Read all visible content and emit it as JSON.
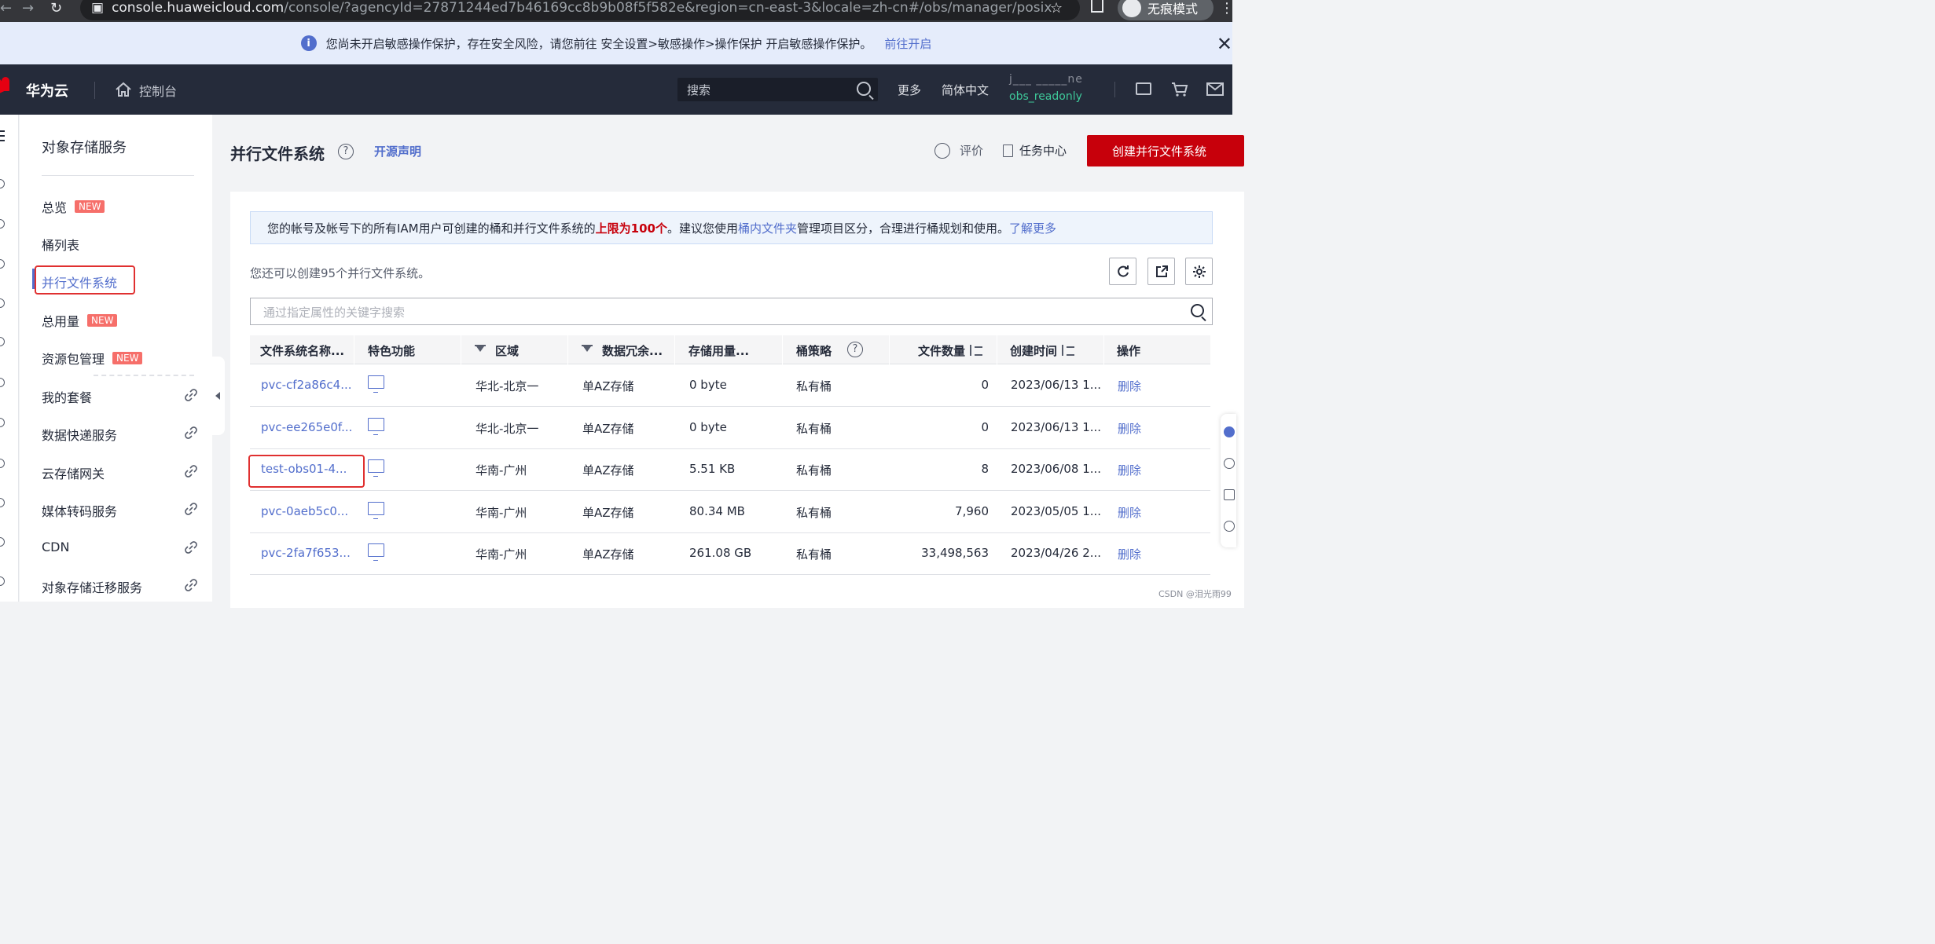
{
  "browser": {
    "url_host": "console.huaweicloud.com",
    "url_path": "/console/?agencyId=27871244ed7b46169cc8b9b08f5f582e&region=cn-east-3&locale=zh-cn#/obs/manager/posix",
    "incognito_label": "无痕模式"
  },
  "banner": {
    "message": "您尚未开启敏感操作保护，存在安全风险，请您前往 安全设置>敏感操作>操作保护 开启敏感操作保护。",
    "link": "前往开启"
  },
  "topnav": {
    "brand": "华为云",
    "console": "控制台",
    "search_placeholder": "搜索",
    "more": "更多",
    "language": "简体中文",
    "user_line1": "j___  _____ne",
    "user_line2": "obs_readonly"
  },
  "sidebar": {
    "title": "对象存储服务",
    "new_tag": "NEW",
    "items": [
      {
        "label": "总览",
        "new": true
      },
      {
        "label": "桶列表",
        "new": false
      },
      {
        "label": "并行文件系统",
        "new": false
      },
      {
        "label": "总用量",
        "new": true
      },
      {
        "label": "资源包管理",
        "new": true
      },
      {
        "label": "我的套餐",
        "link": true
      },
      {
        "label": "数据快递服务",
        "link": true
      },
      {
        "label": "云存储网关",
        "link": true
      },
      {
        "label": "媒体转码服务",
        "link": true
      },
      {
        "label": "CDN",
        "link": true
      },
      {
        "label": "对象存储迁移服务",
        "link": true
      }
    ]
  },
  "page": {
    "title": "并行文件系统",
    "open_source": "开源声明",
    "rate": "评价",
    "task_center": "任务中心",
    "create_button": "创建并行文件系统"
  },
  "notice": {
    "part1": "您的帐号及帐号下的所有IAM用户可创建的桶和并行文件系统的",
    "limit": "上限为100个",
    "part2": "。建议您使用",
    "folder": "桶内文件夹",
    "part3": "管理项目区分，合理进行桶规划和使用。",
    "learn_more": "了解更多"
  },
  "remaining": "您还可以创建95个并行文件系统。",
  "filter_placeholder": "通过指定属性的关键字搜索",
  "table": {
    "columns": [
      "文件系统名称...",
      "特色功能",
      "区域",
      "数据冗余...",
      "存储用量...",
      "桶策略",
      "文件数量",
      "创建时间",
      "操作"
    ],
    "rows": [
      {
        "name": "pvc-cf2a86c4...",
        "region": "华北-北京一",
        "redundancy": "单AZ存储",
        "usage": "0 byte",
        "policy": "私有桶",
        "files": "0",
        "created": "2023/06/13 1...",
        "action": "删除"
      },
      {
        "name": "pvc-ee265e0f...",
        "region": "华北-北京一",
        "redundancy": "单AZ存储",
        "usage": "0 byte",
        "policy": "私有桶",
        "files": "0",
        "created": "2023/06/13 1...",
        "action": "删除"
      },
      {
        "name": "test-obs01-4...",
        "region": "华南-广州",
        "redundancy": "单AZ存储",
        "usage": "5.51 KB",
        "policy": "私有桶",
        "files": "8",
        "created": "2023/06/08 1...",
        "action": "删除"
      },
      {
        "name": "pvc-0aeb5c0...",
        "region": "华南-广州",
        "redundancy": "单AZ存储",
        "usage": "80.34 MB",
        "policy": "私有桶",
        "files": "7,960",
        "created": "2023/05/05 1...",
        "action": "删除"
      },
      {
        "name": "pvc-2fa7f653...",
        "region": "华南-广州",
        "redundancy": "单AZ存储",
        "usage": "261.08 GB",
        "policy": "私有桶",
        "files": "33,498,563",
        "created": "2023/04/26 2...",
        "action": "删除"
      }
    ]
  },
  "watermark": "CSDN @泪光雨99",
  "colors": {
    "accent": "#526ecc",
    "brand_red": "#c7000b",
    "highlight_box": "#e03030"
  }
}
